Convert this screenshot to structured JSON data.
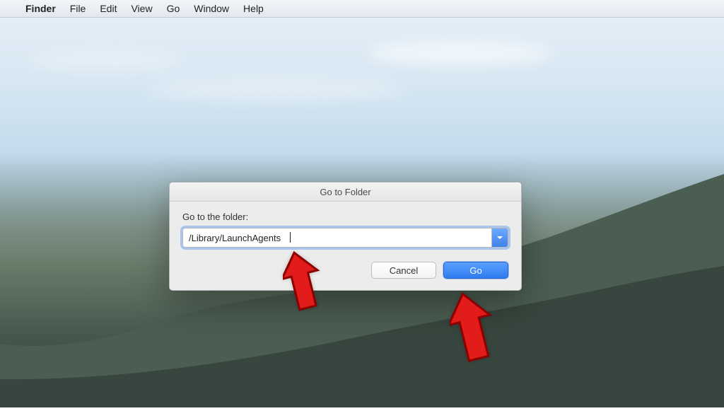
{
  "menubar": {
    "apple_icon": "",
    "app_name": "Finder",
    "items": [
      "File",
      "Edit",
      "View",
      "Go",
      "Window",
      "Help"
    ]
  },
  "dialog": {
    "title": "Go to Folder",
    "label": "Go to the folder:",
    "path_value": "/Library/LaunchAgents",
    "cancel_label": "Cancel",
    "go_label": "Go"
  }
}
